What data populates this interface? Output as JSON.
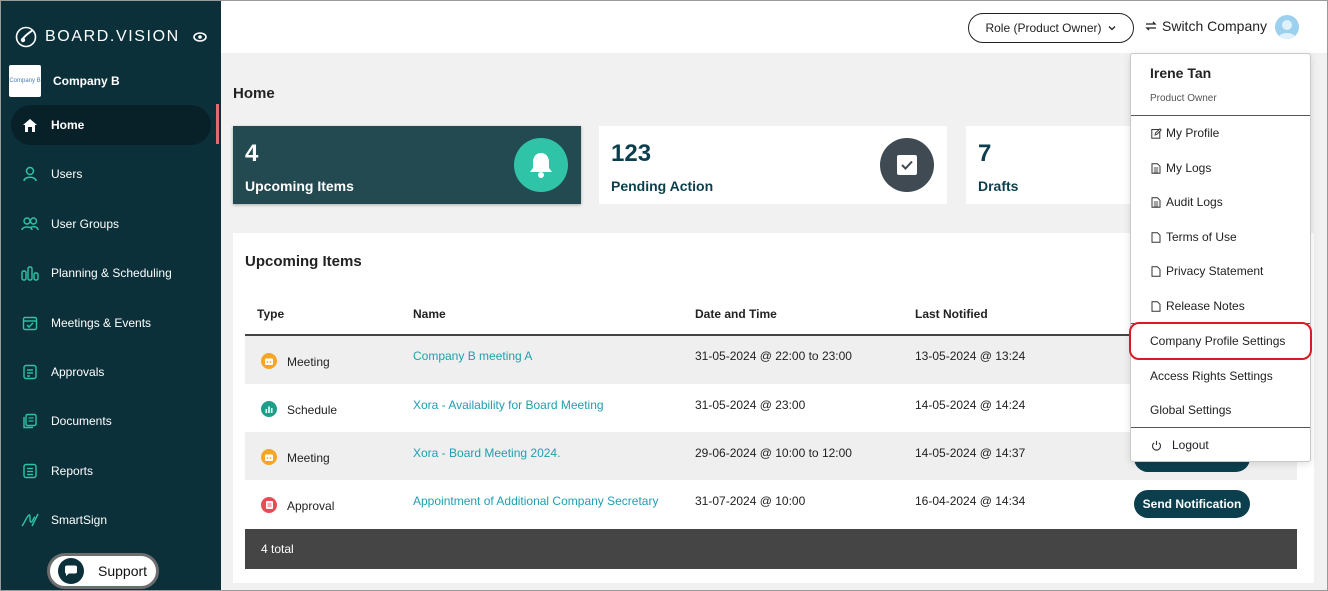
{
  "sidebar": {
    "brand": "BOARD.VISION",
    "company_logo_text": "Company B",
    "company_name": "Company B",
    "items": [
      {
        "label": "Home",
        "icon": "home-icon",
        "active": true
      },
      {
        "label": "Users",
        "icon": "user-icon"
      },
      {
        "label": "User Groups",
        "icon": "user-group-icon"
      },
      {
        "label": "Planning & Scheduling",
        "icon": "bar-chart-icon"
      },
      {
        "label": "Meetings & Events",
        "icon": "calendar-icon"
      },
      {
        "label": "Approvals",
        "icon": "approval-icon"
      },
      {
        "label": "Documents",
        "icon": "documents-icon"
      },
      {
        "label": "Reports",
        "icon": "report-icon"
      },
      {
        "label": "SmartSign",
        "icon": "signature-icon"
      }
    ],
    "support_label": "Support"
  },
  "topbar": {
    "role_label": "Role (Product Owner)",
    "switch_label": "Switch Company"
  },
  "page": {
    "title": "Home",
    "cards": [
      {
        "value": "4",
        "label": "Upcoming Items",
        "icon": "bell-icon"
      },
      {
        "value": "123",
        "label": "Pending Action",
        "icon": "checkbox-icon"
      },
      {
        "value": "7",
        "label": "Drafts"
      }
    ]
  },
  "table": {
    "title": "Upcoming Items",
    "columns": [
      "Type",
      "Name",
      "Date and Time",
      "Last Notified"
    ],
    "rows": [
      {
        "type": "Meeting",
        "type_color": "#f5a623",
        "name": "Company B meeting A",
        "date": "31-05-2024 @ 22:00 to 23:00",
        "last": "13-05-2024 @ 13:24"
      },
      {
        "type": "Schedule",
        "type_color": "#1b9e8a",
        "name": "Xora - Availability for Board Meeting",
        "date": "31-05-2024 @ 23:00",
        "last": "14-05-2024 @ 14:24"
      },
      {
        "type": "Meeting",
        "type_color": "#f5a623",
        "name": "Xora - Board Meeting 2024.",
        "date": "29-06-2024 @ 10:00 to 12:00",
        "last": "14-05-2024 @ 14:37"
      },
      {
        "type": "Approval",
        "type_color": "#e84b55",
        "name": "Appointment of Additional Company Secretary",
        "date": "31-07-2024 @ 10:00",
        "last": "16-04-2024 @ 14:34",
        "action": "Send Notification"
      }
    ],
    "footer": "4 total"
  },
  "dropdown": {
    "user_name": "Irene Tan",
    "user_role": "Product Owner",
    "items": [
      {
        "label": "My Profile",
        "icon": "edit-icon"
      },
      {
        "label": "My Logs",
        "icon": "log-icon"
      },
      {
        "label": "Audit Logs",
        "icon": "log-icon"
      },
      {
        "label": "Terms of Use",
        "icon": "file-icon"
      },
      {
        "label": "Privacy Statement",
        "icon": "file-icon"
      },
      {
        "label": "Release Notes",
        "icon": "file-icon"
      },
      {
        "label": "Company Profile Settings"
      },
      {
        "label": "Access Rights Settings"
      },
      {
        "label": "Global Settings"
      },
      {
        "label": "Logout",
        "icon": "power-icon"
      }
    ]
  },
  "colors": {
    "sidebar_bg": "#0c3039",
    "accent_teal": "#1f9fb0",
    "dark_teal": "#0c3f4d",
    "highlight_red": "#d61c22"
  }
}
